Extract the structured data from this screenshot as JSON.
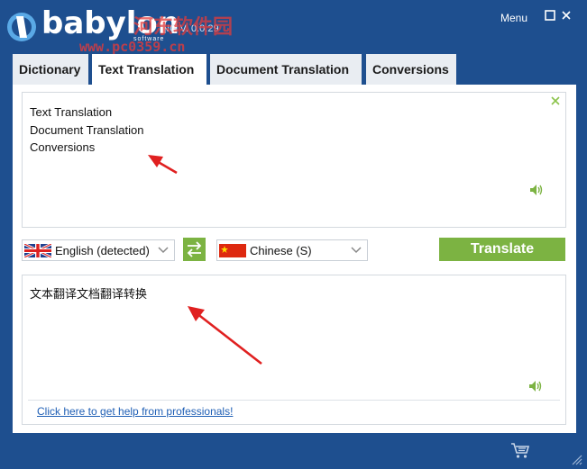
{
  "titlebar": {
    "logo_text": "babylon",
    "logo_subtext": "software",
    "watermark_cn": "河东软件园",
    "watermark_url": "www.pc0359.cn",
    "version": "NG V. 0.0.29",
    "menu_label": "Menu",
    "minimize_icon": "minimize-icon",
    "close_icon": "close-icon"
  },
  "tabs": [
    {
      "label": "Dictionary",
      "active": false
    },
    {
      "label": "Text Translation",
      "active": true
    },
    {
      "label": "Document Translation",
      "active": false
    },
    {
      "label": "Conversions",
      "active": false
    }
  ],
  "source": {
    "lines": [
      "Text Translation",
      "Document Translation",
      "Conversions"
    ],
    "clear_icon": "clear-icon",
    "speaker_icon": "speaker-icon"
  },
  "languages": {
    "source_lang": "English (detected)",
    "source_flag": "uk-flag-icon",
    "target_lang": "Chinese (S)",
    "target_flag": "china-flag-icon",
    "swap_icon": "swap-icon",
    "translate_label": "Translate"
  },
  "target": {
    "text": "文本翻译文档翻译转换",
    "help_link": "Click here to get help from professionals!",
    "speaker_icon": "speaker-icon"
  },
  "footer": {
    "cart_icon": "cart-icon"
  },
  "colors": {
    "frame": "#1e4f8f",
    "accent_green": "#7cb342",
    "link": "#1f5fb5",
    "annotation_arrow": "#e02020"
  }
}
